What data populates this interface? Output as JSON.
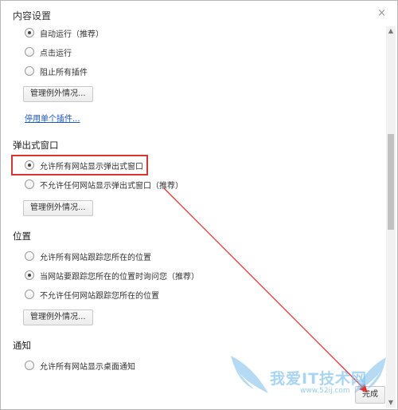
{
  "dialog": {
    "title": "内容设置",
    "close_glyph": "×"
  },
  "plugins": {
    "options": [
      {
        "label": "自动运行（推荐）",
        "checked": true
      },
      {
        "label": "点击运行",
        "checked": false
      },
      {
        "label": "阻止所有插件",
        "checked": false
      }
    ],
    "manage_button": "管理例外情况...",
    "disable_link": "停用单个插件..."
  },
  "popups": {
    "title": "弹出式窗口",
    "options": [
      {
        "label": "允许所有网站显示弹出式窗口",
        "checked": true
      },
      {
        "label": "不允许任何网站显示弹出式窗口（推荐）",
        "checked": false
      }
    ],
    "manage_button": "管理例外情况..."
  },
  "location": {
    "title": "位置",
    "options": [
      {
        "label": "允许所有网站跟踪您所在的位置",
        "checked": false
      },
      {
        "label": "当网站要跟踪您所在的位置时询问您（推荐）",
        "checked": true
      },
      {
        "label": "不允许任何网站跟踪您所在的位置",
        "checked": false
      }
    ],
    "manage_button": "管理例外情况..."
  },
  "notifications": {
    "title": "通知",
    "options": [
      {
        "label": "允许所有网站显示桌面通知",
        "checked": false
      }
    ]
  },
  "footer": {
    "done_button": "完成"
  },
  "watermark": {
    "text": "我爱IT技术网",
    "url": "www.52ij.com"
  },
  "colors": {
    "highlight": "#e13232",
    "link": "#1a56c9"
  }
}
